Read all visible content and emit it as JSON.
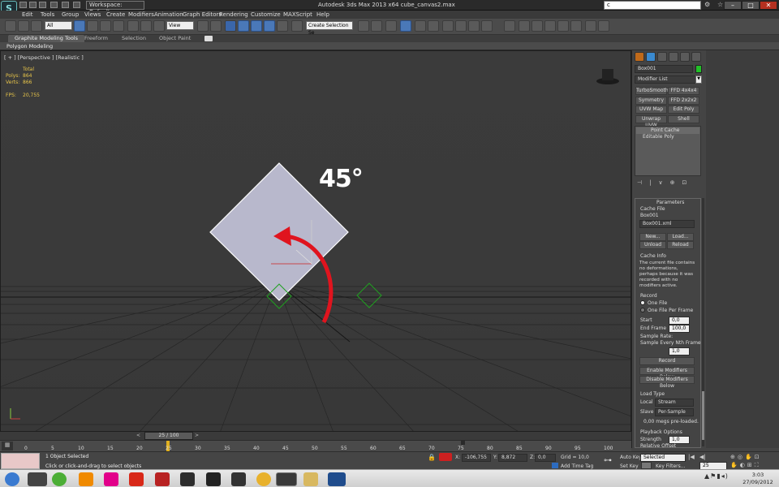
{
  "titlebar": {
    "workspace": "Workspace: Default",
    "window_title": "Autodesk 3ds Max 2013 x64      cube_canvas2.max",
    "search_value": "c"
  },
  "menu": [
    "Edit",
    "Tools",
    "Group",
    "Views",
    "Create",
    "Modifiers",
    "Animation",
    "Graph Editors",
    "Rendering",
    "Customize",
    "MAXScript",
    "Help"
  ],
  "toolbar": {
    "filter": "All",
    "ref_coord": "View",
    "selection_set": "Create Selection Se"
  },
  "ribbon": {
    "tabs": [
      "Graphite Modeling Tools",
      "Freeform",
      "Selection",
      "Object Paint"
    ],
    "sub_label": "Polygon Modeling"
  },
  "viewport": {
    "label": "[ + ] [Perspective ] [Realistic ]",
    "stats_total": "Total",
    "polys_label": "Polys:",
    "polys_value": "864",
    "verts_label": "Verts:",
    "verts_value": "866",
    "fps_label": "FPS:",
    "fps_value": "20,755",
    "annotation": "45°",
    "cube_color": "#b8b8cc",
    "arrow_color": "#e0141e"
  },
  "command_panel": {
    "object_name": "Box001",
    "object_color": "#22c028",
    "modifier_list": "Modifier List",
    "modifier_buttons": [
      "TurboSmooth",
      "FFD 4x4x4",
      "Symmetry",
      "FFD 2x2x2",
      "UVW Map",
      "Edit Poly",
      "Unwrap UVW",
      "Shell"
    ],
    "stack": [
      "Point Cache",
      "Editable Poly"
    ],
    "params_title": "Parameters",
    "cache_file_label": "Cache File",
    "cache_name": "Box001",
    "cache_file": "Box001.xml",
    "new_btn": "New...",
    "load_btn": "Load...",
    "unload_btn": "Unload",
    "reload_btn": "Reload",
    "cache_info_label": "Cache Info",
    "cache_info_text": "The current file contains no deformations, perhaps because it was recorded with no modifiers active.",
    "record_label": "Record",
    "one_file": "One File",
    "one_file_per_frame": "One File Per Frame",
    "start_label": "Start",
    "start_value": "0,0",
    "end_label": "End Frame",
    "end_value": "100,0",
    "sample_rate_label": "Sample Rate:",
    "sample_every_label": "Sample Every Nth Frame",
    "sample_value": "1,0",
    "record_btn": "Record",
    "enable_btn": "Enable Modifiers Below",
    "disable_btn": "Disable Modifiers Below",
    "load_type_label": "Load Type",
    "local_label": "Local",
    "local_value": "Stream",
    "slave_label": "Slave",
    "slave_value": "Per-Sample",
    "loaded_text": "0,00 megs pre-loaded.",
    "playback_label": "Playback Options",
    "strength_label": "Strength",
    "strength_value": "1,0",
    "relative_offset": "Relative Offset"
  },
  "timeline": {
    "frame_label": "25 / 100",
    "ticks": [
      "0",
      "5",
      "10",
      "15",
      "20",
      "25",
      "30",
      "35",
      "40",
      "45",
      "50",
      "55",
      "60",
      "65",
      "70",
      "75",
      "80",
      "85",
      "90",
      "95",
      "100"
    ]
  },
  "status": {
    "selection": "1 Object Selected",
    "prompt": "Click or click-and-drag to select objects",
    "x_label": "X:",
    "x_value": "-106,755",
    "y_label": "Y:",
    "y_value": "8,872",
    "z_label": "Z:",
    "z_value": "0,0",
    "grid": "Grid = 10,0",
    "add_time_tag": "Add Time Tag",
    "auto_key": "Auto Key",
    "set_key": "Set Key",
    "selected_value": "Selected",
    "key_filters": "Key Filters...",
    "frame_value": "25"
  },
  "taskbar": {
    "time": "3:03",
    "date": "27/09/2012"
  }
}
